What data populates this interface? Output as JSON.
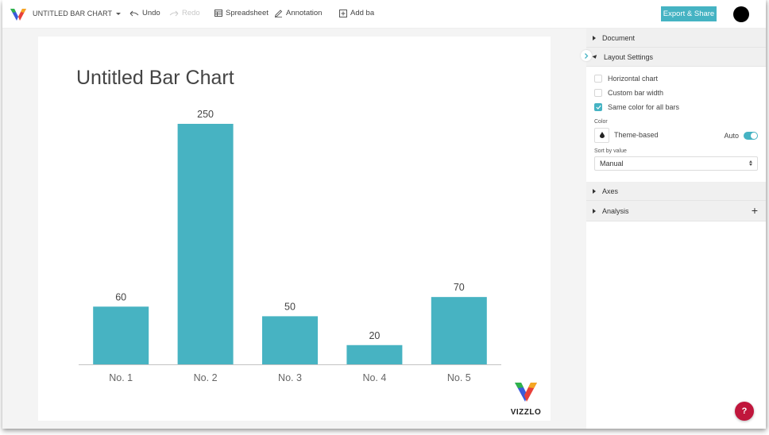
{
  "topbar": {
    "doc_title": "UNTITLED BAR CHART",
    "undo_label": "Undo",
    "redo_label": "Redo",
    "spreadsheet_label": "Spreadsheet",
    "annotation_label": "Annotation",
    "add_bar_label": "Add bar",
    "export_label": "Export & Share"
  },
  "colors": {
    "accent": "#45b3c3",
    "bar": "#47b3c2",
    "help": "#c0163c"
  },
  "chart_data": {
    "type": "bar",
    "title": "Untitled Bar Chart",
    "categories": [
      "No. 1",
      "No. 2",
      "No. 3",
      "No. 4",
      "No. 5"
    ],
    "values": [
      60,
      250,
      50,
      20,
      70
    ],
    "data_labels": [
      "60",
      "250",
      "50",
      "20",
      "70"
    ],
    "xlabel": "",
    "ylabel": "",
    "ylim": [
      0,
      250
    ],
    "grid": false,
    "legend": "none"
  },
  "watermark": {
    "text": "VIZZLO"
  },
  "panel": {
    "sections": {
      "document": "Document",
      "layout": "Layout Settings",
      "axes": "Axes",
      "analysis": "Analysis"
    },
    "layout": {
      "checkboxes": [
        {
          "label": "Horizontal chart",
          "checked": false
        },
        {
          "label": "Custom bar width",
          "checked": false
        },
        {
          "label": "Same color for all bars",
          "checked": true
        }
      ],
      "color_label": "Color",
      "color_value": "Theme-based",
      "auto_label": "Auto",
      "auto_on": true,
      "sort_label": "Sort by value",
      "sort_value": "Manual"
    }
  },
  "help": {
    "label": "?"
  }
}
